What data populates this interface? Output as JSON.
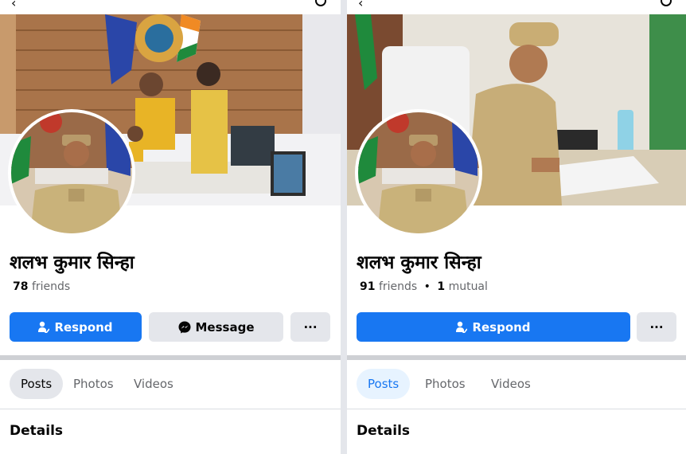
{
  "left": {
    "name": "शलभ कुमार सिन्हा",
    "friends_count": "78",
    "friends_label": "friends",
    "respond_label": "Respond",
    "message_label": "Message",
    "more_label": "···",
    "tabs": [
      {
        "label": "Posts"
      },
      {
        "label": "Photos"
      },
      {
        "label": "Videos"
      }
    ],
    "details_heading": "Details"
  },
  "right": {
    "name": "शलभ कुमार सिन्हा",
    "friends_count": "91",
    "friends_label": "friends",
    "separator": "•",
    "mutual_count": "1",
    "mutual_label": "mutual",
    "respond_label": "Respond",
    "more_label": "···",
    "tabs": [
      {
        "label": "Posts"
      },
      {
        "label": "Photos"
      },
      {
        "label": "Videos"
      }
    ],
    "details_heading": "Details"
  },
  "colors": {
    "accent": "#1877f2",
    "secondary_button": "#e4e6eb",
    "text_primary": "#050505",
    "text_secondary": "#65676b"
  }
}
